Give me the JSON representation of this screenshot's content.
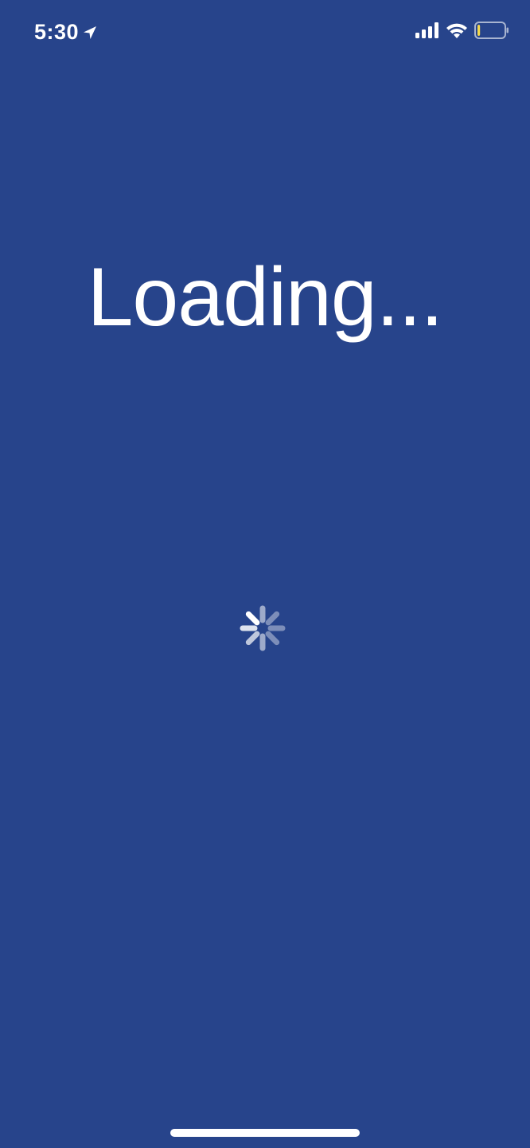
{
  "status_bar": {
    "time": "5:30",
    "icons": [
      "location-arrow-icon",
      "cellular-signal-icon",
      "wifi-icon",
      "battery-low-icon"
    ],
    "battery_fill_fraction": 0.1,
    "battery_fill_color": "#f5d94c"
  },
  "main": {
    "loading_text": "Loading...",
    "spinner_icon": "activity-spinner-icon"
  },
  "colors": {
    "background": "#27448b",
    "foreground": "#ffffff"
  }
}
